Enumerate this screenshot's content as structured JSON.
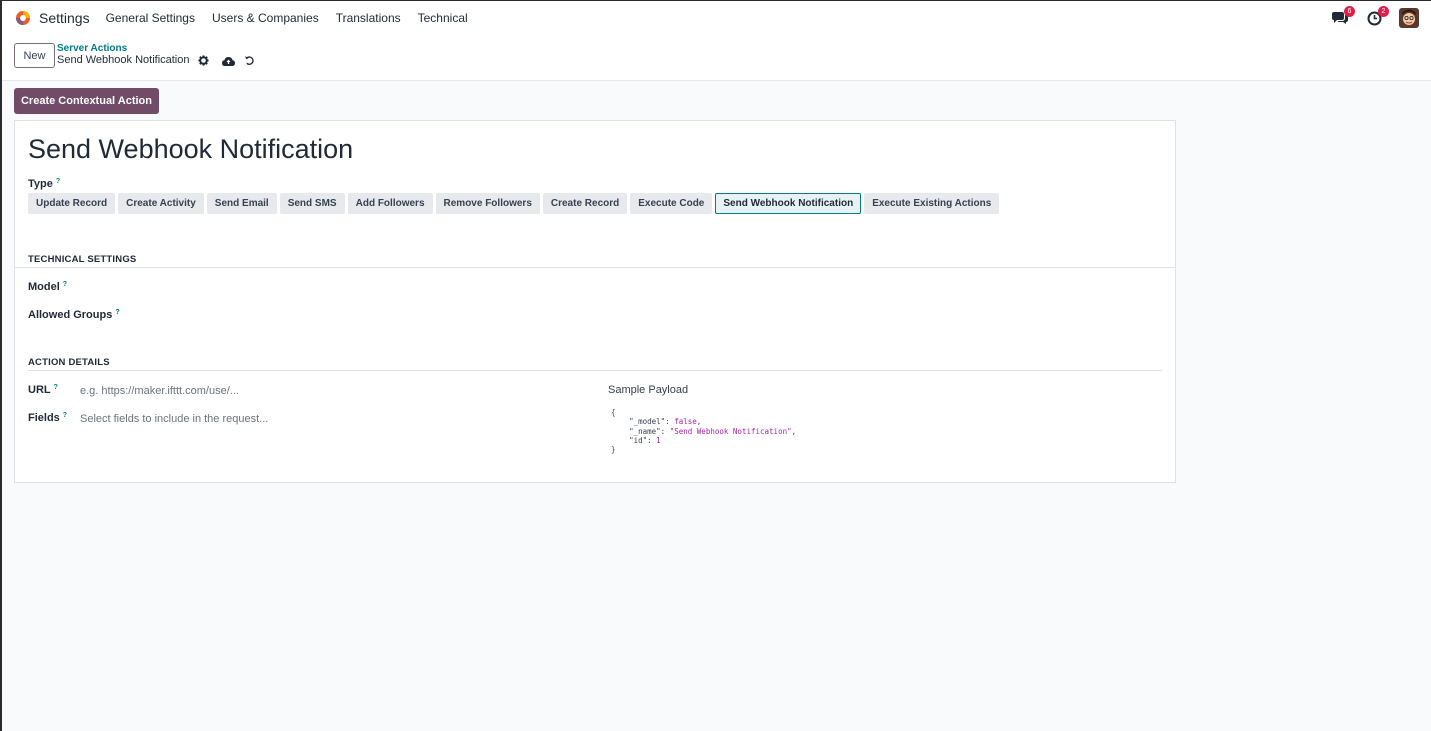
{
  "navbar": {
    "app_name": "Settings",
    "menu": [
      "General Settings",
      "Users & Companies",
      "Translations",
      "Technical"
    ],
    "messages_badge": "6",
    "activities_badge": "2"
  },
  "control_panel": {
    "new_label": "New",
    "breadcrumb_parent": "Server Actions",
    "breadcrumb_current": "Send Webhook Notification"
  },
  "status_bar": {
    "contextual_action_label": "Create Contextual Action"
  },
  "form": {
    "title": "Send Webhook Notification",
    "type_label": "Type",
    "help_mark": "?",
    "types": [
      {
        "label": "Update Record",
        "active": false
      },
      {
        "label": "Create Activity",
        "active": false
      },
      {
        "label": "Send Email",
        "active": false
      },
      {
        "label": "Send SMS",
        "active": false
      },
      {
        "label": "Add Followers",
        "active": false
      },
      {
        "label": "Remove Followers",
        "active": false
      },
      {
        "label": "Create Record",
        "active": false
      },
      {
        "label": "Execute Code",
        "active": false
      },
      {
        "label": "Send Webhook Notification",
        "active": true
      },
      {
        "label": "Execute Existing Actions",
        "active": false
      }
    ],
    "technical_settings": {
      "title": "TECHNICAL SETTINGS",
      "model_label": "Model",
      "groups_label": "Allowed Groups"
    },
    "action_details": {
      "title": "ACTION DETAILS",
      "url_label": "URL",
      "url_placeholder": "e.g. https://maker.ifttt.com/use/...",
      "fields_label": "Fields",
      "fields_placeholder": "Select fields to include in the request...",
      "payload_label": "Sample Payload",
      "payload": {
        "open": "{",
        "model_key": "\"_model\"",
        "model_value": "false",
        "name_key": "\"_name\"",
        "name_value": "\"Send Webhook Notification\"",
        "id_key": "\"id\"",
        "id_value": "1",
        "close": "}"
      }
    }
  },
  "colors": {
    "brand": "#714b67",
    "accent": "#017e84",
    "badge": "#e11d48"
  }
}
